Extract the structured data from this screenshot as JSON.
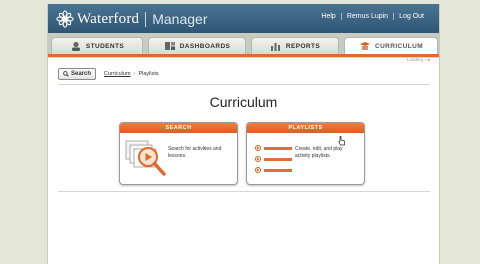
{
  "header": {
    "brand": "Waterford",
    "product": "Manager",
    "nav": [
      {
        "label": "Help"
      },
      {
        "label": "Remus Lupin"
      },
      {
        "label": "Log Out"
      }
    ]
  },
  "tabs": [
    {
      "label": "STUDENTS",
      "icon": "students-icon",
      "active": false
    },
    {
      "label": "DASHBOARDS",
      "icon": "dashboards-icon",
      "active": false
    },
    {
      "label": "REPORTS",
      "icon": "reports-icon",
      "active": false
    },
    {
      "label": "CURRICULUM",
      "icon": "curriculum-icon",
      "active": true
    }
  ],
  "loading": {
    "label": "Loading"
  },
  "toolbar": {
    "search_label": "Search",
    "breadcrumb": [
      "Curriculum",
      "Playlists"
    ],
    "separator": "›"
  },
  "page_title": "Curriculum",
  "cards": {
    "search": {
      "title": "SEARCH",
      "description": "Search for activities and lessons."
    },
    "playlists": {
      "title": "PLAYLISTS",
      "description": "Create, edit, and play activity playlists."
    }
  },
  "colors": {
    "header": "#2f5675",
    "accent": "#e06a2a",
    "background": "#e4e6d8"
  }
}
